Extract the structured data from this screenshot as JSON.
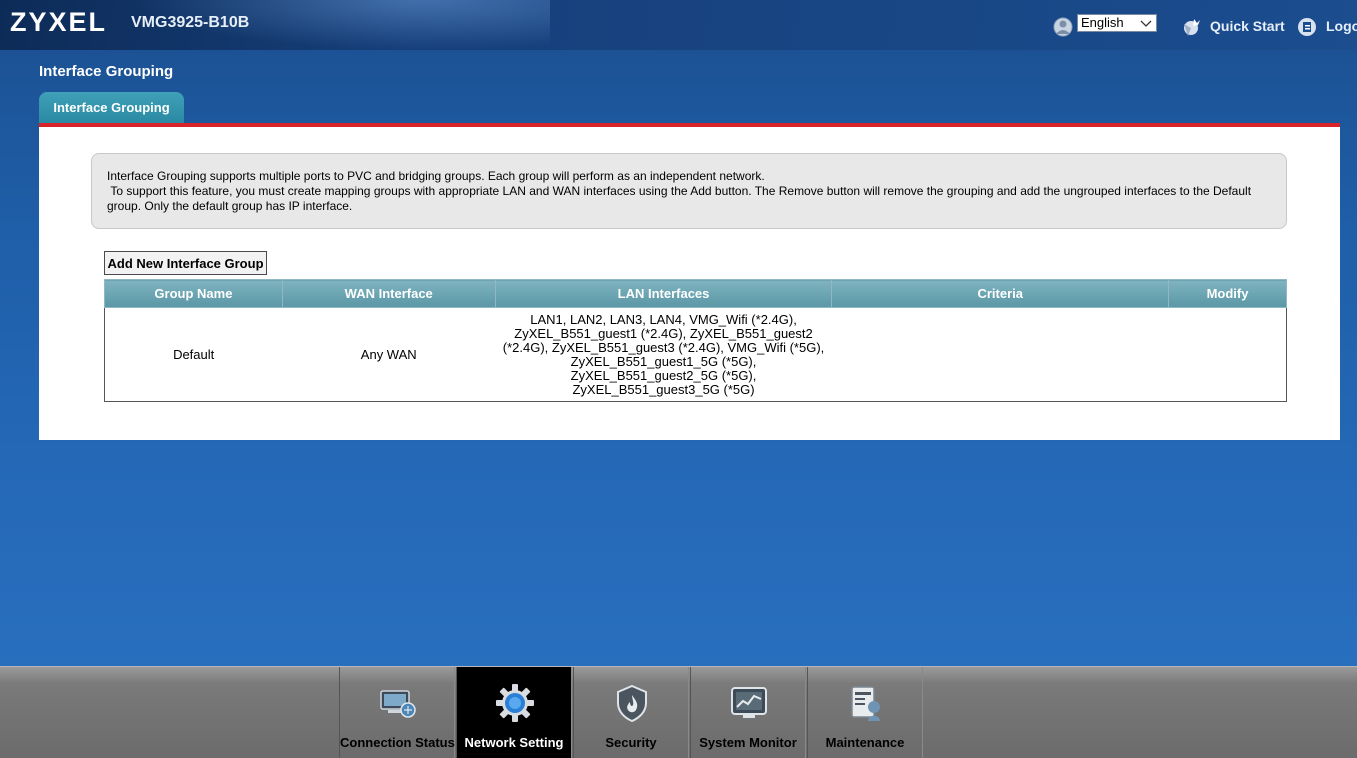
{
  "header": {
    "brand": "ZYXEL",
    "model": "VMG3925-B10B",
    "language": "English",
    "quick_start": "Quick Start",
    "logout": "Logo"
  },
  "page": {
    "title": "Interface Grouping",
    "tab": "Interface Grouping"
  },
  "description": {
    "line1": "Interface Grouping supports multiple ports to PVC and bridging groups. Each group will perform as an independent network.",
    "line2": " To support this feature, you must create mapping groups with appropriate LAN and WAN interfaces using the Add button. The Remove button will remove the grouping and add the ungrouped interfaces to the Default group. Only the default group has IP interface."
  },
  "add_button": "Add New Interface Group",
  "table": {
    "headers": [
      "Group Name",
      "WAN Interface",
      "LAN Interfaces",
      "Criteria",
      "Modify"
    ],
    "rows": [
      {
        "group_name": "Default",
        "wan_interface": "Any WAN",
        "lan_interfaces": [
          "LAN1, LAN2, LAN3, LAN4, VMG_Wifi (*2.4G),",
          "ZyXEL_B551_guest1 (*2.4G), ZyXEL_B551_guest2",
          "(*2.4G), ZyXEL_B551_guest3 (*2.4G), VMG_Wifi (*5G),",
          "ZyXEL_B551_guest1_5G (*5G),",
          "ZyXEL_B551_guest2_5G (*5G),",
          "ZyXEL_B551_guest3_5G (*5G)"
        ],
        "criteria": "",
        "modify": ""
      }
    ]
  },
  "bottom_nav": [
    {
      "label": "Connection Status",
      "icon": "connection-status-icon",
      "active": false
    },
    {
      "label": "Network Setting",
      "icon": "network-setting-gear-icon",
      "active": true
    },
    {
      "label": "Security",
      "icon": "security-shield-icon",
      "active": false
    },
    {
      "label": "System Monitor",
      "icon": "system-monitor-icon",
      "active": false
    },
    {
      "label": "Maintenance",
      "icon": "maintenance-icon",
      "active": false
    }
  ],
  "colors": {
    "background": "#2468b6",
    "tab": "#2a8aa3",
    "red_bar": "#d9232a",
    "table_header": "#5a97a6",
    "nav_active": "#000000"
  }
}
